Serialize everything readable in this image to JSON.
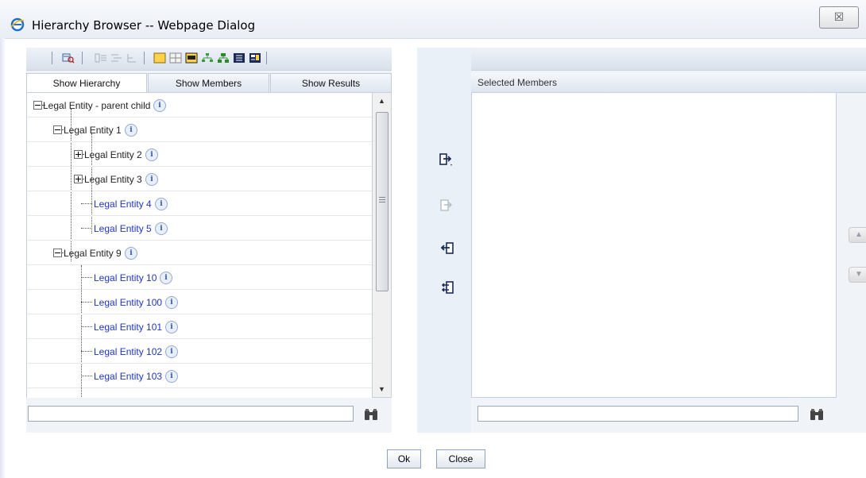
{
  "window": {
    "title": "Hierarchy Browser -- Webpage Dialog",
    "close_glyph": "☒"
  },
  "toolbar": {
    "icons": [
      "find-icon",
      "indent-icon",
      "outdent-icon",
      "level-icon",
      "box-icon",
      "grid-icon",
      "card-icon",
      "tree-icon",
      "org-chart-icon",
      "list-icon",
      "report-icon"
    ]
  },
  "tabs": [
    {
      "label": "Show Hierarchy",
      "active": true
    },
    {
      "label": "Show Members",
      "active": false
    },
    {
      "label": "Show Results",
      "active": false
    }
  ],
  "tree": {
    "rows": [
      {
        "label": "Legal Entity - parent child",
        "level": 0,
        "toggle": "collapse",
        "leaf": false,
        "info_badge": "i"
      },
      {
        "label": "Legal Entity 1",
        "level": 1,
        "toggle": "collapse",
        "leaf": false,
        "info_badge": "i"
      },
      {
        "label": "Legal Entity 2",
        "level": 2,
        "toggle": "expand",
        "leaf": false,
        "info_badge": "i"
      },
      {
        "label": "Legal Entity 3",
        "level": 2,
        "toggle": "expand",
        "leaf": false,
        "info_badge": "i"
      },
      {
        "label": "Legal Entity 4",
        "level": 2,
        "toggle": "none",
        "leaf": true,
        "info_badge": "i"
      },
      {
        "label": "Legal Entity 5",
        "level": 2,
        "toggle": "none",
        "leaf": true,
        "info_badge": "i"
      },
      {
        "label": "Legal Entity 9",
        "level": 1,
        "toggle": "collapse",
        "leaf": false,
        "info_badge": "i"
      },
      {
        "label": "Legal Entity 10",
        "level": 2,
        "toggle": "none",
        "leaf": true,
        "info_badge": "i"
      },
      {
        "label": "Legal Entity 100",
        "level": 2,
        "toggle": "none",
        "leaf": true,
        "info_badge": "i"
      },
      {
        "label": "Legal Entity 101",
        "level": 2,
        "toggle": "none",
        "leaf": true,
        "info_badge": "i"
      },
      {
        "label": "Legal Entity 102",
        "level": 2,
        "toggle": "none",
        "leaf": true,
        "info_badge": "i"
      },
      {
        "label": "Legal Entity 103",
        "level": 2,
        "toggle": "none",
        "leaf": true,
        "info_badge": "i"
      }
    ]
  },
  "left_search": {
    "value": "",
    "placeholder": ""
  },
  "middle_actions": [
    "select-icon",
    "select-disabled-icon",
    "remove-icon",
    "remove-all-icon"
  ],
  "right_panel": {
    "header": "Selected Members",
    "search": {
      "value": "",
      "placeholder": ""
    },
    "move_up_glyph": "▲",
    "move_down_glyph": "▼"
  },
  "footer": {
    "ok_label": "Ok",
    "close_label": "Close"
  },
  "colors": {
    "leaf_link": "#1f35c7",
    "panel_bg": "#f0f3f8",
    "accent": "#2d56a8"
  }
}
